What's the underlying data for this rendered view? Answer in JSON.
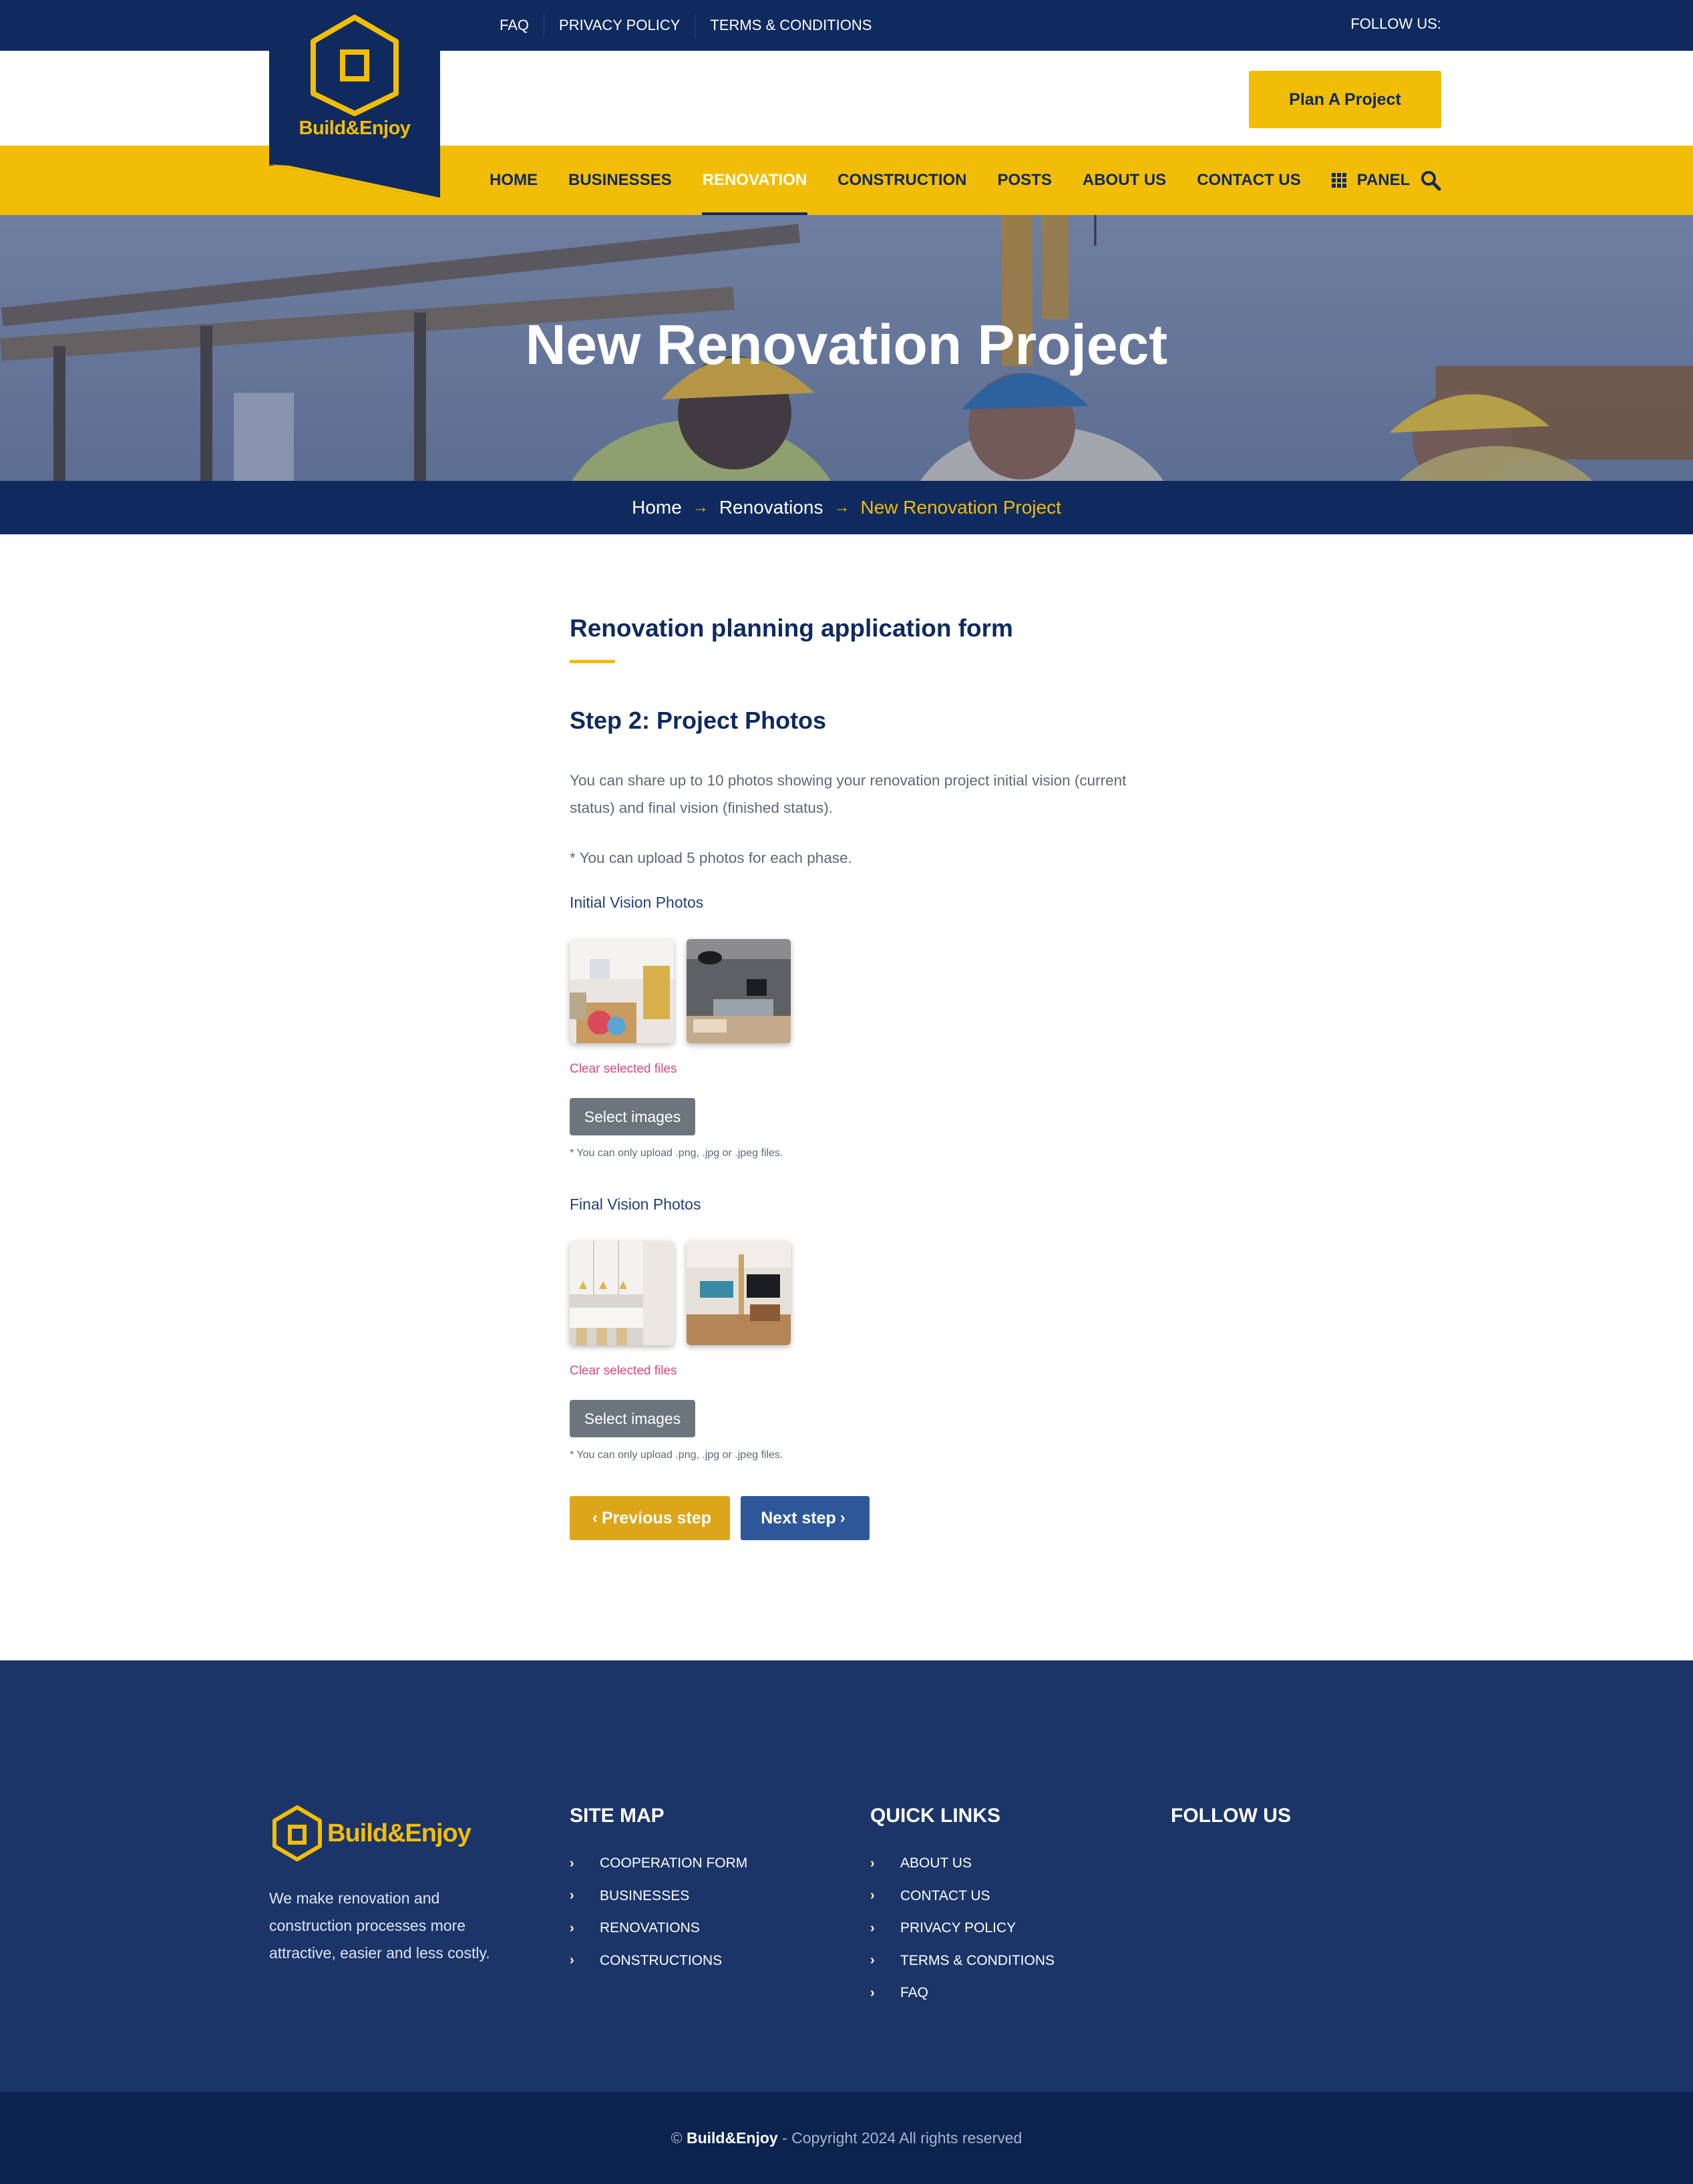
{
  "topbar": {
    "links": [
      "FAQ",
      "PRIVACY POLICY",
      "TERMS & CONDITIONS"
    ],
    "follow_label": "FOLLOW US:"
  },
  "brand": {
    "name": "Build&Enjoy",
    "primary_color": "#0f2a5e",
    "accent_color": "#f2bd06"
  },
  "header": {
    "cta_label": "Plan A Project"
  },
  "nav": {
    "items": [
      "HOME",
      "BUSINESSES",
      "RENOVATION",
      "CONSTRUCTION",
      "POSTS",
      "ABOUT US",
      "CONTACT US",
      "PANEL"
    ],
    "active": "RENOVATION"
  },
  "hero": {
    "title": "New Renovation Project"
  },
  "breadcrumb": {
    "items": [
      "Home",
      "Renovations",
      "New Renovation Project"
    ]
  },
  "form": {
    "title": "Renovation planning application form",
    "step_title": "Step 2: Project Photos",
    "description": "You can share up to 10 photos showing your renovation project initial vision (current status) and final vision (finished status).",
    "note": "* You can upload 5 photos for each phase.",
    "sections": [
      {
        "label": "Initial Vision Photos",
        "clear_label": "Clear selected files",
        "select_label": "Select images",
        "hint": "* You can only upload .png, .jpg or .jpeg files."
      },
      {
        "label": "Final Vision Photos",
        "clear_label": "Clear selected files",
        "select_label": "Select images",
        "hint": "* You can only upload .png, .jpg or .jpeg files."
      }
    ],
    "prev_label": "Previous step",
    "next_label": "Next step"
  },
  "footer": {
    "description": "We make renovation and construction processes more attractive, easier and less costly.",
    "site_map": {
      "heading": "SITE MAP",
      "items": [
        "COOPERATION FORM",
        "BUSINESSES",
        "RENOVATIONS",
        "CONSTRUCTIONS"
      ]
    },
    "quick_links": {
      "heading": "QUICK LINKS",
      "items": [
        "ABOUT US",
        "CONTACT US",
        "PRIVACY POLICY",
        "TERMS & CONDITIONS",
        "FAQ"
      ]
    },
    "follow_heading": "FOLLOW US",
    "copyright_brand": "Build&Enjoy",
    "copyright_text": "- Copyright 2024 All rights reserved"
  },
  "icons": {
    "logo": "house-hexagon-icon",
    "search": "search-icon",
    "panel": "grid-icon",
    "breadcrumb_separator": "arrow-right-icon",
    "list_bullet": "chevron-right-icon"
  }
}
